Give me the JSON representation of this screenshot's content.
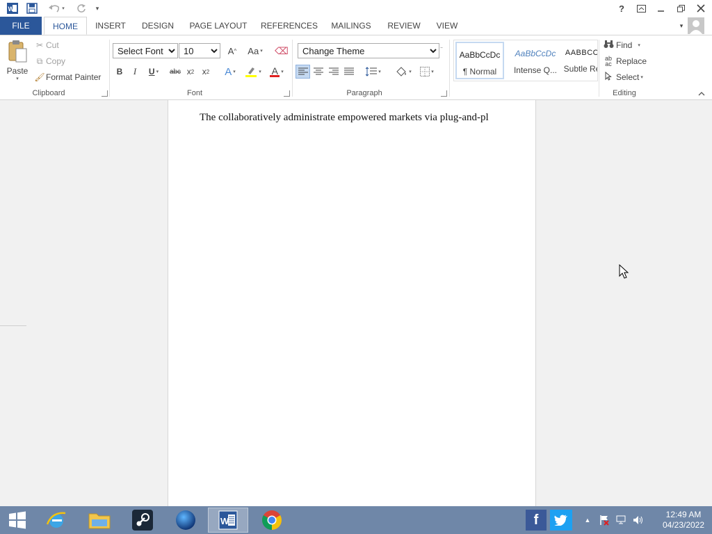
{
  "app": {
    "colors": {
      "accent": "#2b579a",
      "taskbar": "#6f87a8",
      "page": "#ffffff"
    }
  },
  "tabs": [
    {
      "label": "FILE"
    },
    {
      "label": "HOME"
    },
    {
      "label": "INSERT"
    },
    {
      "label": "DESIGN"
    },
    {
      "label": "PAGE LAYOUT"
    },
    {
      "label": "REFERENCES"
    },
    {
      "label": "MAILINGS"
    },
    {
      "label": "REVIEW"
    },
    {
      "label": "VIEW"
    }
  ],
  "titlebar": {
    "help": "?"
  },
  "clipboard": {
    "label": "Clipboard",
    "paste": "Paste",
    "cut": "Cut",
    "copy": "Copy",
    "format_painter": "Format Painter"
  },
  "font": {
    "label": "Font",
    "font_name": "Select Font",
    "font_size": "10",
    "grow_glyph": "A",
    "case_glyph": "Aa",
    "bold": "B",
    "italic": "I",
    "underline": "U",
    "strike": "abc",
    "sub": "x",
    "sup": "x",
    "effects_glyph": "A",
    "color_glyph": "A"
  },
  "paragraph": {
    "label": "Paragraph",
    "theme": "Change Theme"
  },
  "styles": {
    "items": [
      {
        "preview": "AaBbCcDc",
        "name": "¶ Normal"
      },
      {
        "preview": "AaBbCcDc",
        "name": "Intense Q..."
      },
      {
        "preview": "AABBCC",
        "name": "Subtle Re"
      }
    ]
  },
  "editing": {
    "label": "Editing",
    "find": "Find",
    "replace": "Replace",
    "select": "Select"
  },
  "document": {
    "text": "The collaboratively administrate empowered markets via plug-and-pl"
  },
  "taskbar": {
    "apps": [
      "start-icon",
      "internet-explorer-icon",
      "file-explorer-icon",
      "steam-icon",
      "globe-app-icon",
      "word-icon",
      "chrome-icon"
    ]
  },
  "clock": {
    "time": "12:49 AM",
    "date": "04/23/2022"
  }
}
